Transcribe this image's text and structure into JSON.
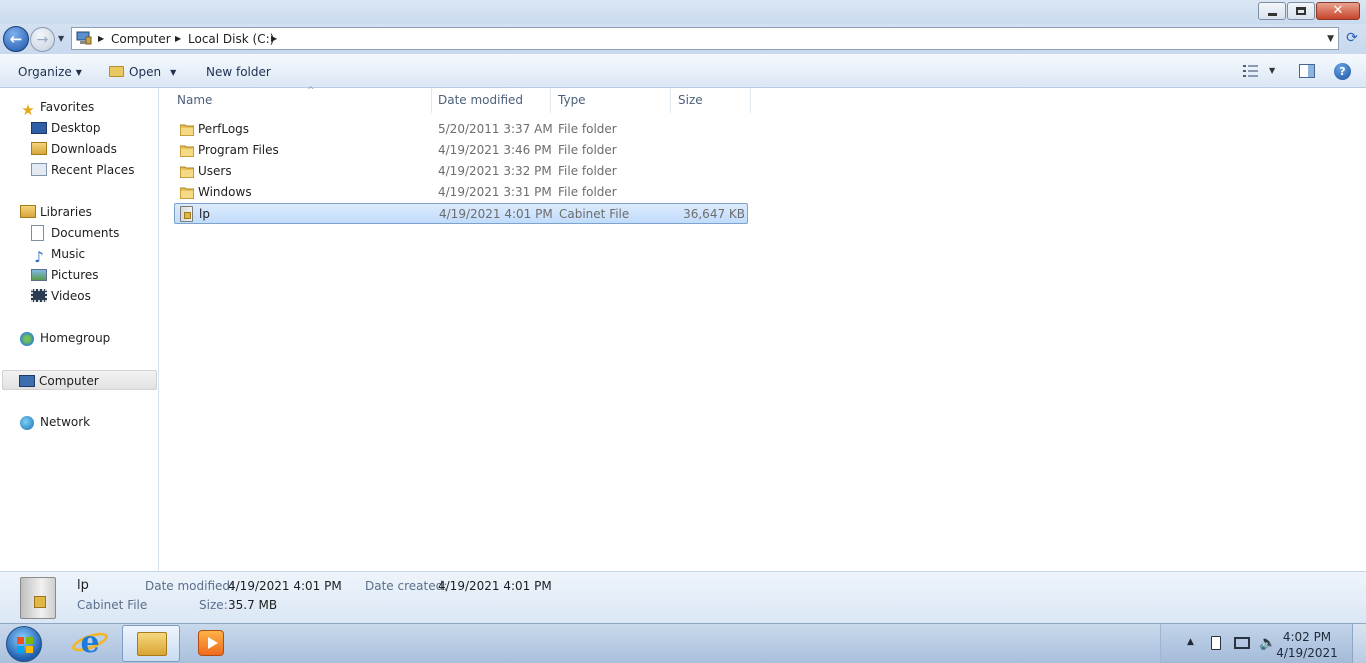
{
  "address": {
    "crumbs": [
      "Computer",
      "Local Disk (C:)"
    ]
  },
  "toolbar": {
    "organize_label": "Organize",
    "open_label": "Open",
    "new_folder_label": "New folder"
  },
  "nav": {
    "favorites_label": "Favorites",
    "favorites": [
      "Desktop",
      "Downloads",
      "Recent Places"
    ],
    "libraries_label": "Libraries",
    "libraries": [
      "Documents",
      "Music",
      "Pictures",
      "Videos"
    ],
    "homegroup_label": "Homegroup",
    "computer_label": "Computer",
    "network_label": "Network"
  },
  "columns": [
    "Name",
    "Date modified",
    "Type",
    "Size"
  ],
  "files": [
    {
      "name": "PerfLogs",
      "date": "5/20/2011 3:37 AM",
      "type": "File folder",
      "size": ""
    },
    {
      "name": "Program Files",
      "date": "4/19/2021 3:46 PM",
      "type": "File folder",
      "size": ""
    },
    {
      "name": "Users",
      "date": "4/19/2021 3:32 PM",
      "type": "File folder",
      "size": ""
    },
    {
      "name": "Windows",
      "date": "4/19/2021 3:31 PM",
      "type": "File folder",
      "size": ""
    },
    {
      "name": "lp",
      "date": "4/19/2021 4:01 PM",
      "type": "Cabinet File",
      "size": "36,647 KB"
    }
  ],
  "details": {
    "name": "lp",
    "type": "Cabinet File",
    "date_modified_label": "Date modified:",
    "date_modified": "4/19/2021 4:01 PM",
    "size_label": "Size:",
    "size": "35.7 MB",
    "date_created_label": "Date created:",
    "date_created": "4/19/2021 4:01 PM"
  },
  "taskbar": {
    "time": "4:02 PM",
    "date": "4/19/2021"
  },
  "colors": {
    "selection": "#cce4fb",
    "accent": "#1c56a8"
  }
}
